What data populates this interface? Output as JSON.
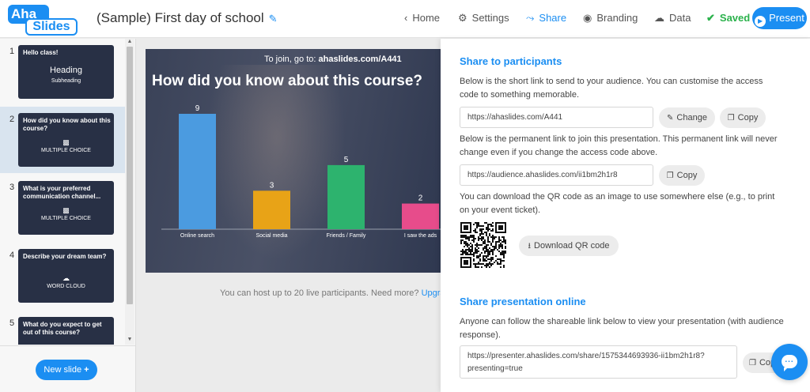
{
  "app": {
    "logo_top": "Aha",
    "logo_bottom": "Slides",
    "title": "(Sample) First day of school"
  },
  "nav": {
    "home": "Home",
    "settings": "Settings",
    "share": "Share",
    "branding": "Branding",
    "data": "Data",
    "saved": "Saved",
    "present": "Present"
  },
  "icons": {
    "home": "chevron-left-icon",
    "settings": "gear-icon",
    "share": "share-icon",
    "branding": "palette-icon",
    "data": "cloud-icon",
    "saved": "check-circle-icon",
    "present": "play-icon"
  },
  "slides": [
    {
      "num": "1",
      "title": "Hello class!",
      "heading": "Heading",
      "subheading": "Subheading"
    },
    {
      "num": "2",
      "title": "How did you know about this course?",
      "type": "MULTIPLE CHOICE"
    },
    {
      "num": "3",
      "title": "What is your preferred communication channel...",
      "type": "MULTIPLE CHOICE"
    },
    {
      "num": "4",
      "title": "Describe your dream team?",
      "type": "WORD CLOUD"
    },
    {
      "num": "5",
      "title": "What do you expect to get out of this course?"
    }
  ],
  "sidebar": {
    "new_slide": "New slide"
  },
  "preview": {
    "join_prefix": "To join, go to: ",
    "join_url": "ahaslides.com/A441",
    "question": "How did you know about this course?"
  },
  "chart_data": {
    "type": "bar",
    "categories": [
      "Online search",
      "Social media",
      "Friends / Family",
      "I saw the ads"
    ],
    "values": [
      9,
      3,
      5,
      2
    ],
    "colors": [
      "#4b9be0",
      "#e8a317",
      "#2db36e",
      "#e74c8b"
    ],
    "ylim": [
      0,
      9
    ]
  },
  "host_info": {
    "text": "You can host up to 20 live participants. Need more? ",
    "link": "Upgra"
  },
  "share": {
    "participants_heading": "Share to participants",
    "short_link_desc": "Below is the short link to send to your audience. You can customise the access code to something memorable.",
    "short_link": "https://ahaslides.com/A441",
    "change_label": "Change",
    "copy_label": "Copy",
    "permanent_desc": "Below is the permanent link to join this presentation. This permanent link will never change even if you change the access code above.",
    "permanent_link": "https://audience.ahaslides.com/ii1bm2h1r8",
    "qr_desc": "You can download the QR code as an image to use somewhere else (e.g., to print on your event ticket).",
    "download_qr": "Download QR code",
    "online_heading": "Share presentation online",
    "online_desc": "Anyone can follow the shareable link below to view your presentation (with audience response).",
    "presenter_link_line1": "https://presenter.ahaslides.com/share/1575344693936-ii1bm2h1r8?",
    "presenter_link_line2": "presenting=true",
    "copy_partial": "Cop"
  }
}
